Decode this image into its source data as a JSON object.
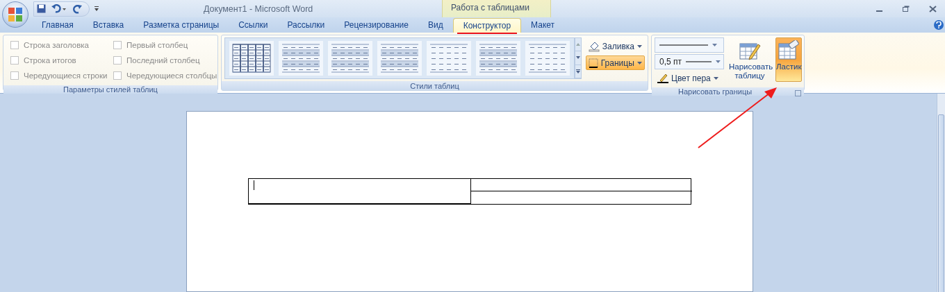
{
  "title_bar": {
    "document_title": "Документ1  -  Microsoft Word",
    "contextual_group": "Работа с таблицами"
  },
  "tabs": [
    {
      "label": "Главная",
      "selected": false
    },
    {
      "label": "Вставка",
      "selected": false
    },
    {
      "label": "Разметка страницы",
      "selected": false
    },
    {
      "label": "Ссылки",
      "selected": false
    },
    {
      "label": "Рассылки",
      "selected": false
    },
    {
      "label": "Рецензирование",
      "selected": false
    },
    {
      "label": "Вид",
      "selected": false
    },
    {
      "label": "Конструктор",
      "selected": true
    },
    {
      "label": "Макет",
      "selected": false
    }
  ],
  "ribbon": {
    "style_options": {
      "caption": "Параметры стилей таблиц",
      "checkboxes": [
        {
          "label": "Строка заголовка",
          "checked": false
        },
        {
          "label": "Строка итогов",
          "checked": false
        },
        {
          "label": "Чередующиеся строки",
          "checked": false
        },
        {
          "label": "Первый столбец",
          "checked": false
        },
        {
          "label": "Последний столбец",
          "checked": false
        },
        {
          "label": "Чередующиеся столбцы",
          "checked": false
        }
      ]
    },
    "table_styles": {
      "caption": "Стили таблиц",
      "gallery": [
        {
          "kind": "grid"
        },
        {
          "kind": "banded"
        },
        {
          "kind": "banded"
        },
        {
          "kind": "banded"
        },
        {
          "kind": "lines"
        },
        {
          "kind": "banded"
        },
        {
          "kind": "lines"
        }
      ],
      "shading": {
        "label": "Заливка"
      },
      "borders": {
        "label": "Границы",
        "selected": true
      }
    },
    "draw_borders": {
      "caption": "Нарисовать границы",
      "line_weight": "0,5 пт",
      "pen_color": "Цвет пера",
      "draw_table": {
        "label": "Нарисовать таблицу",
        "selected": false
      },
      "eraser": {
        "label": "Ластик",
        "selected": true
      }
    }
  },
  "document": {
    "table": {
      "show_cursor": true
    }
  }
}
